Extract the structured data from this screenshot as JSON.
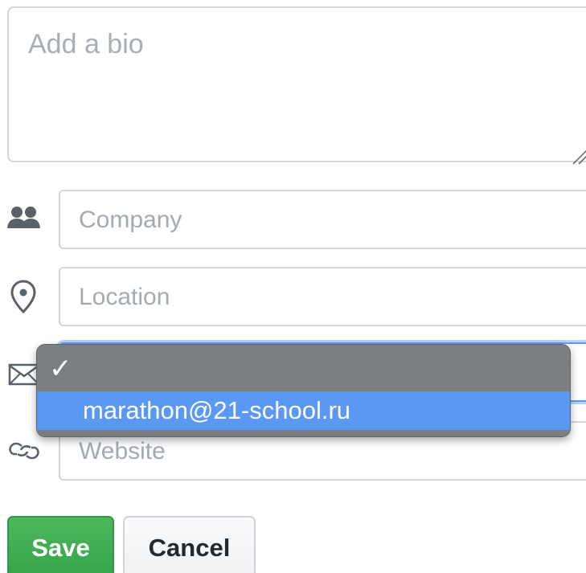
{
  "bio": {
    "placeholder": "Add a bio"
  },
  "fields": {
    "company": {
      "placeholder": "Company",
      "icon": "people-icon"
    },
    "location": {
      "placeholder": "Location",
      "icon": "location-pin-icon"
    },
    "email": {
      "icon": "mail-icon"
    },
    "website": {
      "placeholder": "Website",
      "icon": "link-icon"
    }
  },
  "email_dropdown": {
    "check_glyph": "✓",
    "options": [
      {
        "label": "",
        "checked": true
      },
      {
        "label": "marathon@21-school.ru",
        "highlighted": true
      }
    ]
  },
  "actions": {
    "save_label": "Save",
    "cancel_label": "Cancel"
  },
  "colors": {
    "save_button": "#36a64a",
    "focus_ring": "#5d9cf0",
    "menu_background": "#7c7f82",
    "menu_highlight": "#5b97f4"
  }
}
